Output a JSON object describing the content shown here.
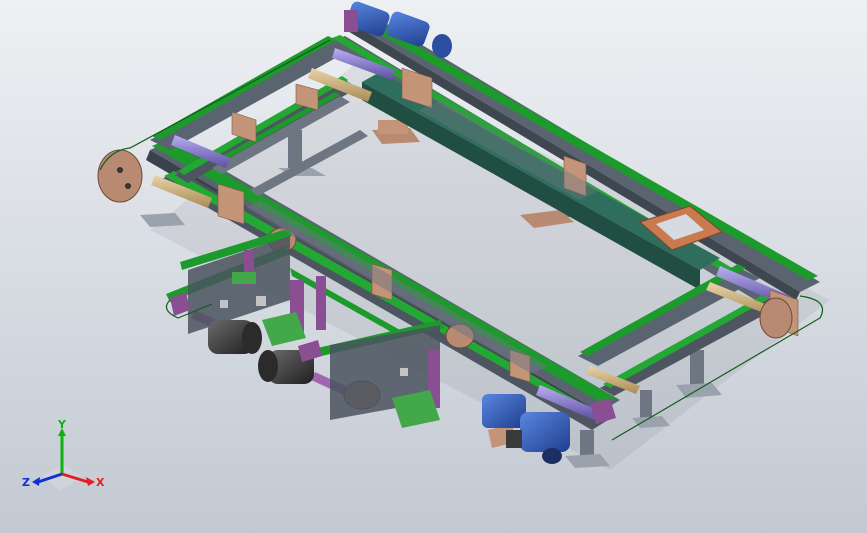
{
  "axes": {
    "x_label": "X",
    "y_label": "Y",
    "z_label": "Z",
    "x_color": "#e02020",
    "y_color": "#10b010",
    "z_color": "#1030d0"
  },
  "colors": {
    "belt": "#1c9a2c",
    "frame": "#5a6470",
    "plate": "#b98a72",
    "motor": "#2f5fbf",
    "roller": "#8a7ad0",
    "purple_part": "#8a4f93",
    "teal_panel": "#2f6e5c",
    "dark_motor": "#3a3a3a",
    "background_top": "#eef0f3",
    "background_bottom": "#c3c9d2"
  }
}
